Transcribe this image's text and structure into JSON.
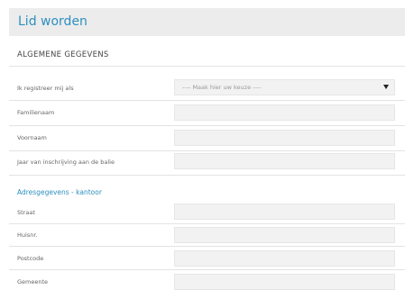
{
  "page": {
    "title": "Lid worden"
  },
  "general": {
    "heading": "ALGEMENE GEGEVENS",
    "register_as": {
      "label": "Ik registreer mij als",
      "value": "---- Maak hier uw keuze ----"
    },
    "family_name": {
      "label": "Familienaam",
      "value": ""
    },
    "first_name": {
      "label": "Voornaam",
      "value": ""
    },
    "year": {
      "label": "Jaar van inschrijving aan de balie",
      "value": ""
    }
  },
  "address": {
    "heading": "Adresgegevens - kantoor",
    "street": {
      "label": "Straat",
      "value": ""
    },
    "house_number": {
      "label": "Huisnr.",
      "value": ""
    },
    "postcode": {
      "label": "Postcode",
      "value": ""
    },
    "municipality": {
      "label": "Gemeente",
      "value": ""
    }
  },
  "colors": {
    "accent": "#2c8fbf",
    "header_bg": "#ececec",
    "field_bg": "#f2f2f2"
  }
}
